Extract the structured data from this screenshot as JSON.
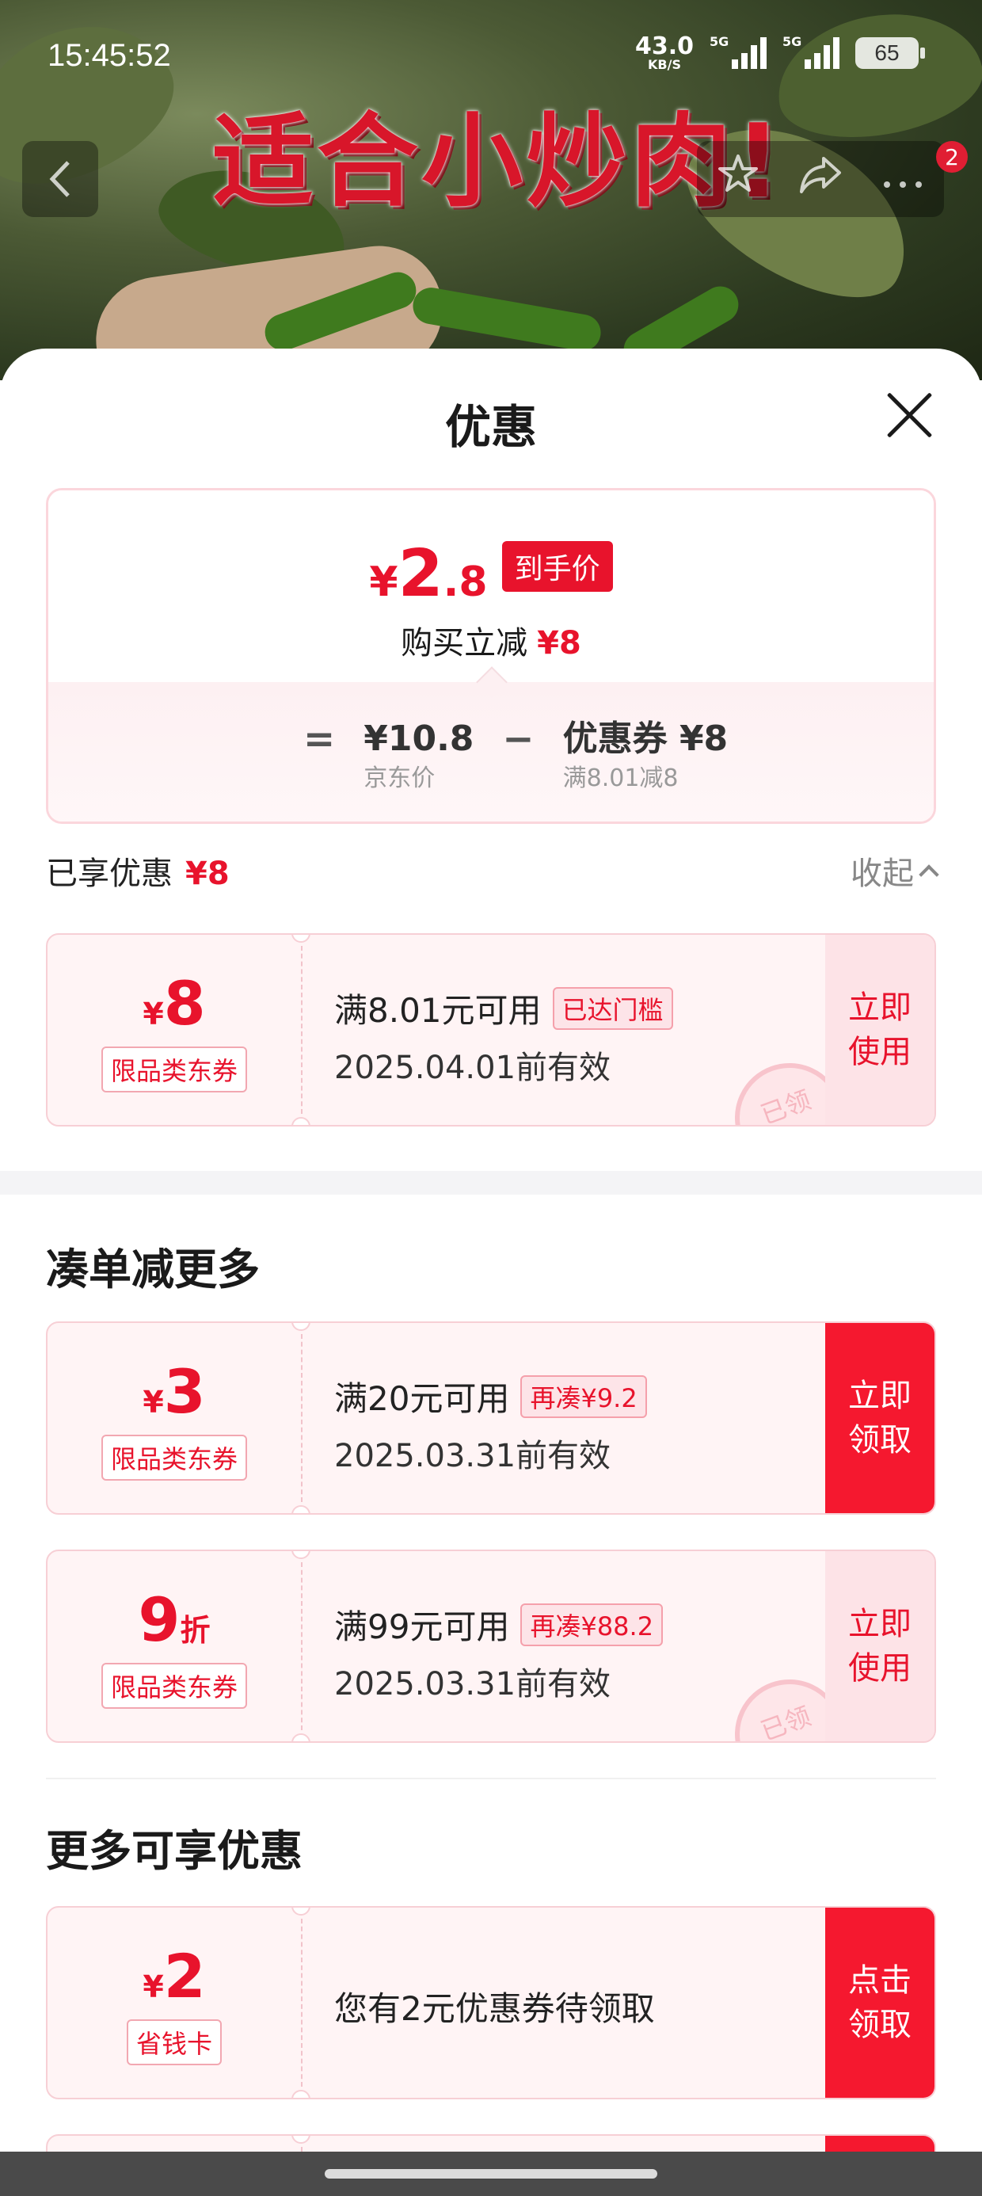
{
  "status_bar": {
    "time": "15:45:52",
    "net_speed": "43.0",
    "net_unit": "KB/S",
    "sig1_tag": "5G",
    "sig2_tag": "5G",
    "battery": "65"
  },
  "banner": {
    "headline": "适合小炒肉!",
    "notification_count": "2"
  },
  "sheet": {
    "title": "优惠",
    "price": {
      "yen": "¥",
      "integer": "2",
      "decimal": ".8",
      "tag": "到手价",
      "reduce_label": "购买立减",
      "reduce_value": "¥8"
    },
    "formula": {
      "equals": "=",
      "jd_price": "¥10.8",
      "jd_label": "京东价",
      "minus": "−",
      "coupon_main": "优惠券 ¥8",
      "coupon_sub": "满8.01减8"
    },
    "enjoyed": {
      "label": "已享优惠",
      "value": "¥8",
      "collapse": "收起"
    },
    "enjoyed_coupon": {
      "yen": "¥",
      "amount": "8",
      "type": "限品类东券",
      "condition": "满8.01元可用",
      "pill": "已达门槛",
      "date": "2025.04.01前有效",
      "action": "立即使用",
      "stamp": "已领"
    },
    "more_section_title": "凑单减更多",
    "more_coupons": [
      {
        "yen": "¥",
        "amount": "3",
        "unit": "",
        "type": "限品类东券",
        "condition": "满20元可用",
        "pill": "再凑¥9.2",
        "date": "2025.03.31前有效",
        "action": "立即领取"
      },
      {
        "yen": "",
        "amount": "9",
        "unit": "折",
        "type": "限品类东券",
        "condition": "满99元可用",
        "pill": "再凑¥88.2",
        "date": "2025.03.31前有效",
        "action": "立即使用",
        "stamp": "已领"
      }
    ],
    "extra_section_title": "更多可享优惠",
    "extra_coupon": {
      "yen": "¥",
      "amount": "2",
      "type": "省钱卡",
      "text": "您有2元优惠券待领取",
      "action": "点击领取"
    }
  },
  "colors": {
    "brand_red": "#e8132c",
    "button_red": "#f5182f",
    "coupon_bg": "#fff4f5"
  }
}
